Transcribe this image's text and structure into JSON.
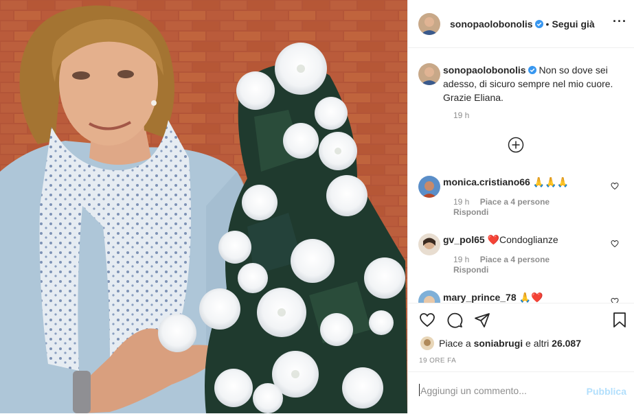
{
  "header": {
    "username": "sonopaolobonolis",
    "separator": "•",
    "follow_label": "Segui già",
    "more_label": "···"
  },
  "caption": {
    "username": "sonopaolobonolis",
    "text": "Non so dove sei adesso, di sicuro sempre nel mio cuore. Grazie Eliana.",
    "time": "19 h"
  },
  "comments": [
    {
      "username": "monica.cristiano66",
      "text": "🙏🙏🙏",
      "time": "19 h",
      "likes": "Piace a 4 persone",
      "reply": "Rispondi"
    },
    {
      "username": "gv_pol65",
      "text": "❤️Condoglianze",
      "time": "19 h",
      "likes": "Piace a 4 persone",
      "reply": "Rispondi"
    },
    {
      "username": "mary_prince_78",
      "text": "🙏❤️",
      "time": "",
      "likes": "",
      "reply": ""
    }
  ],
  "likes": {
    "prefix": "Piace a",
    "user": "soniabrugi",
    "suffix": "e altri",
    "count": "26.087"
  },
  "timestamp": "19 ORE FA",
  "add_comment": {
    "placeholder": "Aggiungi un commento...",
    "publish_label": "Pubblica"
  },
  "colors": {
    "verified": "#3897f0",
    "publish_disabled": "#b2dffc",
    "meta_text": "#8e8e8e",
    "border": "#efefef"
  }
}
